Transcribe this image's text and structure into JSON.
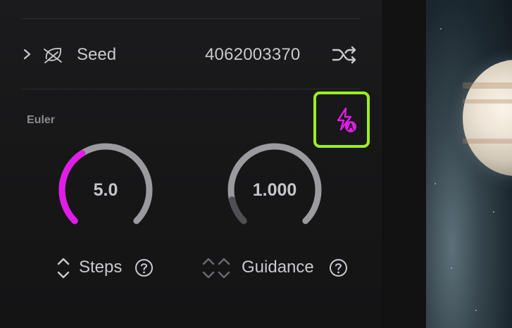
{
  "seed": {
    "label": "Seed",
    "value": "4062003370"
  },
  "sampler": {
    "name": "Euler"
  },
  "controls": [
    {
      "label": "Steps",
      "value": "5.0",
      "fill_fraction": 0.38
    },
    {
      "label": "Guidance",
      "value": "1.000",
      "fill_fraction": 0.12
    }
  ],
  "icons": {
    "chevron": "chevron-right-icon",
    "seed": "leaf-icon",
    "shuffle": "shuffle-icon",
    "auto": "lightning-auto-icon",
    "stepper": "up-down-chevron-icon",
    "help": "question-circle-icon"
  },
  "colors": {
    "accent": "#e21ce8",
    "highlight_border": "#9bef1f",
    "dial_track": "#9a9a9f",
    "dial_dim_fill": "#4f4f54",
    "text": "#c9c9ce",
    "muted_text": "#8a8a90"
  }
}
